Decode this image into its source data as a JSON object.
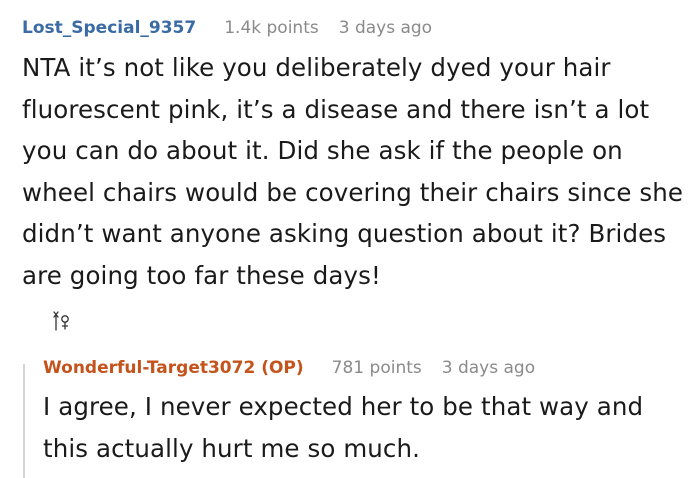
{
  "comments": [
    {
      "username": "Lost_Special_9357",
      "points": "1.4k points",
      "age": "3 days ago",
      "text": "NTA it’s not like you deliberately dyed your hair fluorescent pink, it’s a disease and there isn’t a lot you can do about it. Did she ask if the people on wheel chairs would be covering their chairs since she didn’t want anyone asking question about it? Brides are going too far these days!"
    },
    {
      "username": "Wonderful-Target3072 (OP)",
      "points": "781 points",
      "age": "3 days ago",
      "text": "I agree, I never expected her to be that way and this actually hurt me so much."
    }
  ],
  "award_icon": "award-icon",
  "colors": {
    "username_blue": "#3b6ba5",
    "username_op": "#c4531c",
    "meta_gray": "#8a8a8a",
    "thread_line": "#d4d4d4"
  }
}
